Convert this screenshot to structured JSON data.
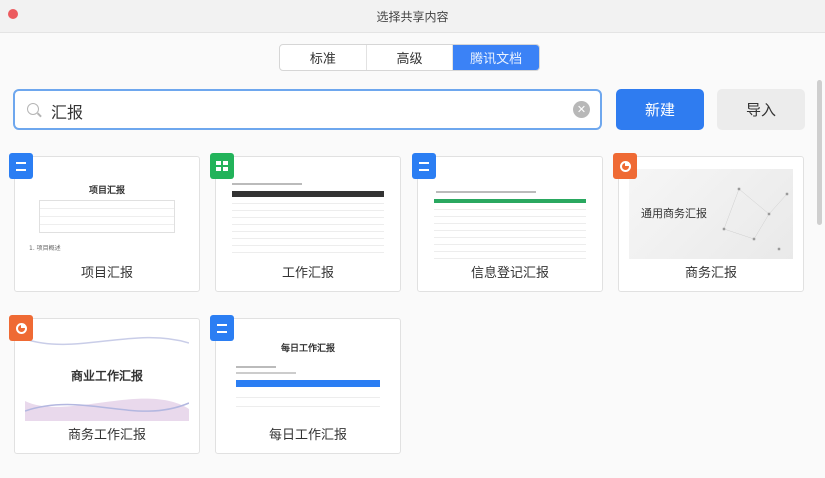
{
  "window": {
    "title": "选择共享内容"
  },
  "tabs": [
    {
      "label": "标准",
      "active": false
    },
    {
      "label": "高级",
      "active": false
    },
    {
      "label": "腾讯文档",
      "active": true
    }
  ],
  "search": {
    "value": "汇报",
    "placeholder": ""
  },
  "buttons": {
    "new_label": "新建",
    "import_label": "导入"
  },
  "colors": {
    "accent": "#2f7cf0",
    "doc": "#2b7ef3",
    "sheet": "#22b35a",
    "slides": "#ef6a34"
  },
  "templates": [
    {
      "name": "项目汇报",
      "type": "doc",
      "icon": "doc-icon",
      "thumb_title": "项目汇报",
      "thumb_footer": "1. 项目概述"
    },
    {
      "name": "工作汇报",
      "type": "sheet",
      "icon": "sheet-icon"
    },
    {
      "name": "信息登记汇报",
      "type": "doc",
      "icon": "doc-icon"
    },
    {
      "name": "商务汇报",
      "type": "slides",
      "icon": "slides-icon",
      "thumb_title": "通用商务汇报"
    },
    {
      "name": "商务工作汇报",
      "type": "slides",
      "icon": "slides-icon",
      "thumb_title": "商业工作汇报"
    },
    {
      "name": "每日工作汇报",
      "type": "doc",
      "icon": "doc-icon",
      "thumb_title": "每日工作汇报"
    }
  ]
}
